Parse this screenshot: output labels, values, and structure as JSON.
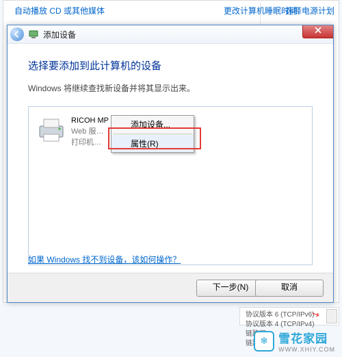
{
  "bg": {
    "link_autoplay": "自动播放 CD 或其他媒体",
    "link_time": "更改计算机睡眠时间",
    "link_power": "选择电源计划",
    "bottom_lines": [
      "协议版本 6 (TCP/IPv6)",
      "协议版本 4 (TCP/IPv4)",
      "链路层…",
      "链路层…"
    ]
  },
  "dialog": {
    "title": "添加设备",
    "heading": "选择要添加到此计算机的设备",
    "subtext": "Windows 将继续查找新设备并将其显示出来。",
    "device": {
      "name": "RICOH MP C3503",
      "line2": "Web 服…",
      "line3": "打印机…"
    },
    "context_menu": {
      "item_add": "添加设备...",
      "item_props": "属性(R)"
    },
    "help_link": "如果 Windows 找不到设备，该如何操作？",
    "btn_next": "下一步(N)",
    "btn_cancel": "取消"
  },
  "watermark": {
    "brand": "雪花家园",
    "url": "WWW.XHIY.COM"
  }
}
